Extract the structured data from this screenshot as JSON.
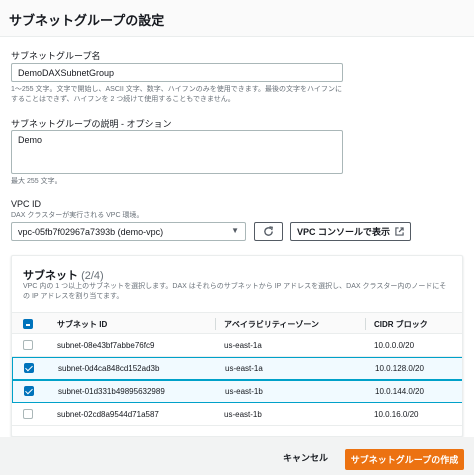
{
  "header": {
    "title": "サブネットグループの設定"
  },
  "name_field": {
    "label": "サブネットグループ名",
    "value": "DemoDAXSubnetGroup",
    "hint_line1": "1〜255 文字。文字で開始し、ASCII 文字、数字、ハイフンのみを使用できます。最後の文字をハイフンに",
    "hint_line2": "することはできず、ハイフンを 2 つ続けて使用することもできません。"
  },
  "description_field": {
    "label": "サブネットグループの説明 - オプション",
    "value": "Demo",
    "hint": "最大 255 文字。"
  },
  "vpc": {
    "label": "VPC ID",
    "hint": "DAX クラスターが実行される VPC 環境。",
    "selected": "vpc-05fb7f02967a7393b (demo-vpc)",
    "console_button": "VPC コンソールで表示"
  },
  "subnets": {
    "title": "サブネット",
    "count": "(2/4)",
    "desc_line1": "VPC 内の 1 つ以上のサブネットを選択します。DAX はそれらのサブネットから IP アドレスを選択し、DAX クラスター内のノードにそ",
    "desc_line2": "の IP アドレスを割り当てます。",
    "columns": {
      "id": "サブネット ID",
      "az": "アベイラビリティーゾーン",
      "cidr": "CIDR ブロック"
    },
    "rows": [
      {
        "id": "subnet-08e43bf7abbe76fc9",
        "az": "us-east-1a",
        "cidr": "10.0.0.0/20",
        "selected": false
      },
      {
        "id": "subnet-0d4ca848cd152ad3b",
        "az": "us-east-1a",
        "cidr": "10.0.128.0/20",
        "selected": true
      },
      {
        "id": "subnet-01d331b49895632989",
        "az": "us-east-1b",
        "cidr": "10.0.144.0/20",
        "selected": true
      },
      {
        "id": "subnet-02cd8a9544d71a587",
        "az": "us-east-1b",
        "cidr": "10.0.16.0/20",
        "selected": false
      }
    ]
  },
  "footer": {
    "cancel": "キャンセル",
    "create": "サブネットグループの作成"
  },
  "colors": {
    "primary": "#ec7211",
    "selection": "#0073bb",
    "selected_row_border": "#00a1c9"
  },
  "icons": {
    "refresh": "refresh-icon",
    "external": "external-link-icon",
    "caret": "caret-down-icon"
  }
}
